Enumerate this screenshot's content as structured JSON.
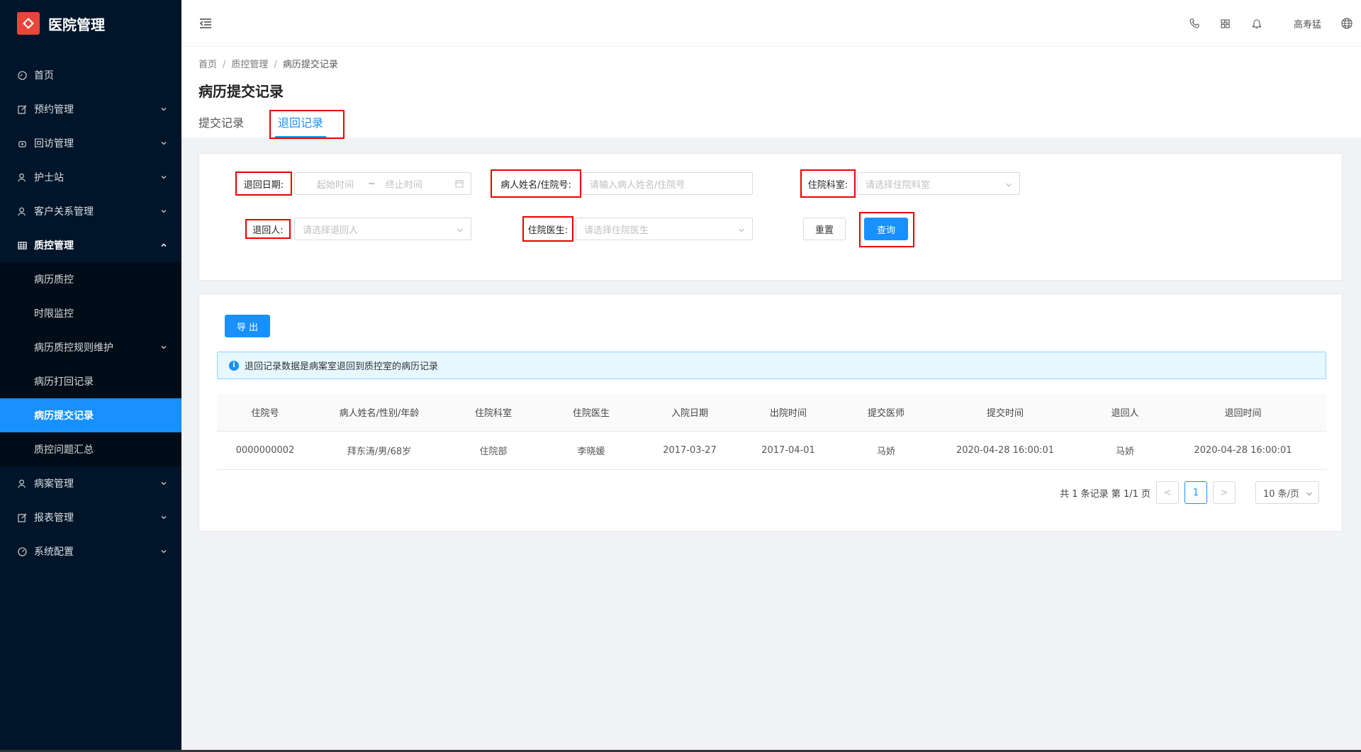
{
  "app": {
    "title": "医院管理"
  },
  "sidebar": {
    "items": [
      {
        "label": "首页",
        "icon": "dashboard-icon"
      },
      {
        "label": "预约管理",
        "icon": "edit-icon"
      },
      {
        "label": "回访管理",
        "icon": "phone-icon"
      },
      {
        "label": "护士站",
        "icon": "user-icon"
      },
      {
        "label": "客户关系管理",
        "icon": "user-icon"
      },
      {
        "label": "质控管理",
        "icon": "table-icon"
      },
      {
        "label": "病案管理",
        "icon": "user-icon"
      },
      {
        "label": "报表管理",
        "icon": "edit-icon"
      },
      {
        "label": "系统配置",
        "icon": "gauge-icon"
      }
    ],
    "submenu": [
      {
        "label": "病历质控"
      },
      {
        "label": "时限监控"
      },
      {
        "label": "病历质控规则维护"
      },
      {
        "label": "病历打回记录"
      },
      {
        "label": "病历提交记录"
      },
      {
        "label": "质控问题汇总"
      }
    ]
  },
  "header": {
    "username": "高寿猛"
  },
  "breadcrumb": [
    "首页",
    "质控管理",
    "病历提交记录"
  ],
  "page": {
    "title": "病历提交记录"
  },
  "tabs": [
    {
      "label": "提交记录"
    },
    {
      "label": "退回记录"
    }
  ],
  "filters": {
    "return_date_label": "退回日期:",
    "start_placeholder": "起始时间",
    "range_sep": "~",
    "end_placeholder": "终止时间",
    "patient_label": "病人姓名/住院号:",
    "patient_placeholder": "请输入病人姓名/住院号",
    "dept_label": "住院科室:",
    "dept_placeholder": "请选择住院科室",
    "returner_label": "退回人:",
    "returner_placeholder": "请选择退回人",
    "doctor_label": "住院医生:",
    "doctor_placeholder": "请选择住院医生",
    "reset_label": "重置",
    "query_label": "查询"
  },
  "toolbar": {
    "export_label": "导 出"
  },
  "alert": {
    "icon": "i",
    "text": "退回记录数据是病案室退回到质控室的病历记录"
  },
  "table": {
    "columns": [
      "住院号",
      "病人姓名/性别/年龄",
      "住院科室",
      "住院医生",
      "入院日期",
      "出院时间",
      "提交医师",
      "提交时间",
      "退回人",
      "退回时间"
    ],
    "rows": [
      [
        "0000000002",
        "拜东涛/男/68岁",
        "住院部",
        "李晓媛",
        "2017-03-27",
        "2017-04-01",
        "马娇",
        "2020-04-28 16:00:01",
        "马娇",
        "2020-04-28 16:00:01"
      ]
    ]
  },
  "pagination": {
    "summary": "共 1 条记录 第 1/1 页",
    "prev": "<",
    "current": "1",
    "next": ">",
    "page_size": "10 条/页"
  },
  "colors": {
    "primary": "#1890ff",
    "sidebar_bg": "#001529",
    "highlight": "#e00000"
  }
}
